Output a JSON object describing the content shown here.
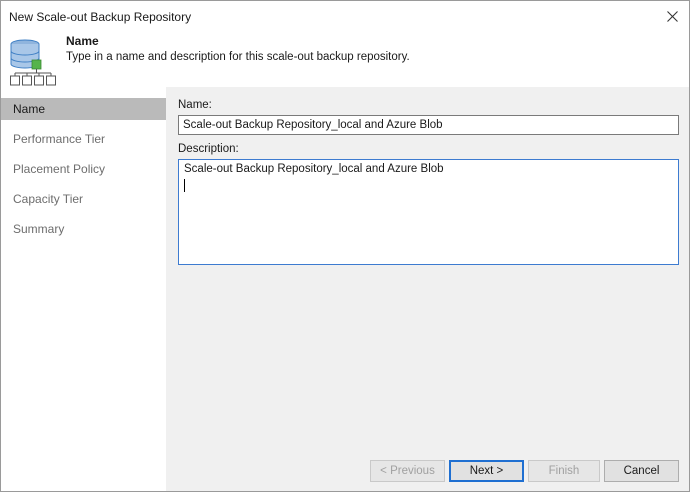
{
  "window": {
    "title": "New Scale-out Backup Repository",
    "close_icon": "close-icon"
  },
  "header": {
    "icon": "scale-out-repository-icon",
    "title": "Name",
    "description": "Type in a name and description for this scale-out backup repository."
  },
  "sidebar": {
    "items": [
      {
        "label": "Name",
        "active": true
      },
      {
        "label": "Performance Tier",
        "active": false
      },
      {
        "label": "Placement Policy",
        "active": false
      },
      {
        "label": "Capacity Tier",
        "active": false
      },
      {
        "label": "Summary",
        "active": false
      }
    ]
  },
  "form": {
    "name_label": "Name:",
    "name_value": "Scale-out Backup Repository_local and Azure Blob",
    "description_label": "Description:",
    "description_value": "Scale-out Backup Repository_local and Azure Blob"
  },
  "footer": {
    "previous_label": "< Previous",
    "next_label": "Next >",
    "finish_label": "Finish",
    "cancel_label": "Cancel"
  },
  "colors": {
    "sidebar_active": "#bababa",
    "content_bg": "#f0f0f0",
    "focus_border": "#3d7bd0",
    "icon_accent": "#55b44b",
    "icon_blue": "#3e7fc4"
  }
}
